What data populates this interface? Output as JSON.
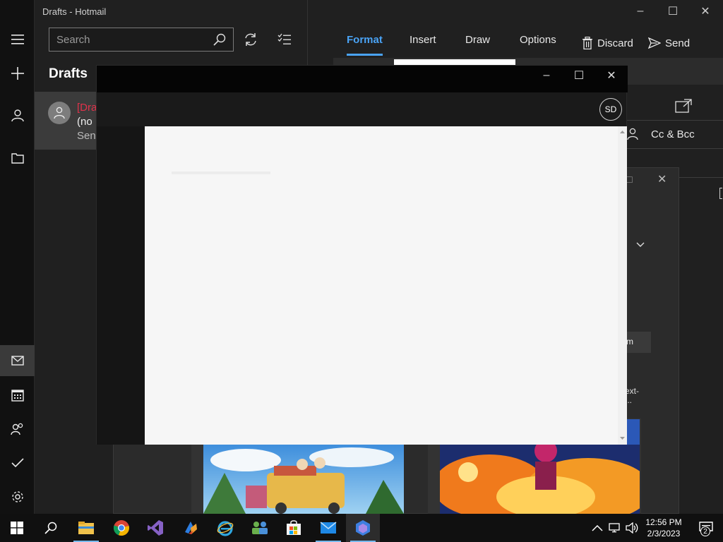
{
  "window": {
    "title": "Drafts - Hotmail",
    "minimize": "–",
    "maximize": "☐",
    "close": "✕"
  },
  "rail": {
    "items": [
      {
        "name": "hamburger-icon",
        "glyph": "☰"
      },
      {
        "name": "new-mail-icon",
        "glyph": "+"
      },
      {
        "name": "account-icon",
        "glyph": "👤"
      },
      {
        "name": "folder-icon",
        "glyph": "🗀"
      },
      {
        "name": "mail-icon",
        "glyph": "✉"
      },
      {
        "name": "calendar-icon",
        "glyph": "📅"
      },
      {
        "name": "people-icon",
        "glyph": "👥"
      },
      {
        "name": "todo-icon",
        "glyph": "✔"
      },
      {
        "name": "settings-icon",
        "glyph": "⚙"
      }
    ]
  },
  "search": {
    "placeholder": "Search"
  },
  "folder": {
    "heading": "Drafts"
  },
  "message": {
    "draft_label": "[Dra",
    "subject": "(no",
    "sent": "Sent"
  },
  "compose": {
    "tabs": {
      "format": "Format",
      "insert": "Insert",
      "draw": "Draw",
      "options": "Options",
      "discard": "Discard",
      "send": "Send"
    },
    "cc_bcc": "Cc & Bcc"
  },
  "bg_popup": {
    "snippet_m": "m",
    "snippet_next": "ext-",
    "snippet_dots": "..."
  },
  "fg_window": {
    "profile_initials": "SD",
    "minimize": "–",
    "maximize": "☐",
    "close": "✕"
  },
  "taskbar": {
    "time": "12:56 PM",
    "date": "2/3/2023",
    "notification_count": "2"
  },
  "colors": {
    "accent": "#4aa3f5",
    "draft_red": "#e0324b"
  }
}
